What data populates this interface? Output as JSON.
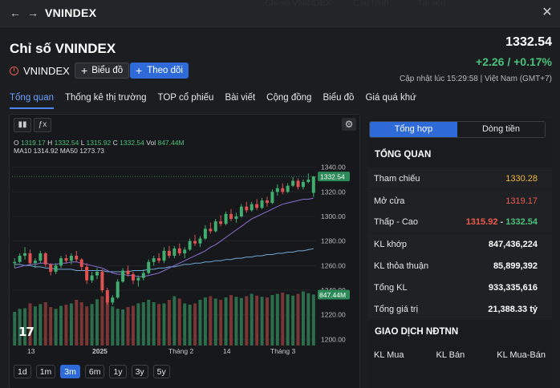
{
  "window": {
    "title": "VNINDEX",
    "ghost_tabs": [
      "Chỉ số VNINDEX",
      "Cấu hình",
      "Tài liệu"
    ]
  },
  "header": {
    "title": "Chỉ số VNINDEX",
    "symbol": "VNINDEX",
    "chart_button": "Biểu đồ",
    "follow_button": "Theo dõi",
    "price": "1332.54",
    "change": "+2.26 / +0.17%",
    "updated": "Cập nhật lúc  15:29:58 | Việt Nam (GMT+7)"
  },
  "tabs": [
    "Tổng quan",
    "Thống kê thị trường",
    "TOP cổ phiếu",
    "Bài viết",
    "Cộng đồng",
    "Biểu đồ",
    "Giá quá khứ"
  ],
  "chart": {
    "ohlc": {
      "o_label": "O",
      "o": "1319.17",
      "h_label": "H",
      "h": "1332.54",
      "l_label": "L",
      "l": "1315.92",
      "c_label": "C",
      "c": "1332.54",
      "vol_label": "Vol",
      "vol": "847.44M"
    },
    "ma": {
      "ma10_label": "MA10",
      "ma10": "1314.92",
      "ma50_label": "MA50",
      "ma50": "1273.73"
    },
    "last_price_tag": "1332.54",
    "volume_tag": "847.44M",
    "ranges": [
      "1d",
      "1m",
      "3m",
      "6m",
      "1y",
      "3y",
      "5y"
    ],
    "active_range": "3m",
    "logo_text": "17"
  },
  "chart_data": {
    "type": "candlestick",
    "y_ticks": [
      "1340.00",
      "1320.00",
      "1300.00",
      "1280.00",
      "1260.00",
      "1240.00",
      "1220.00",
      "1200.00"
    ],
    "ylim": [
      1195,
      1345
    ],
    "x_ticks": [
      "13",
      "2025",
      "Tháng 2",
      "14",
      "Tháng 3"
    ],
    "candles": [
      [
        1262,
        1266,
        1258,
        1263
      ],
      [
        1263,
        1270,
        1262,
        1268
      ],
      [
        1268,
        1275,
        1265,
        1270
      ],
      [
        1270,
        1273,
        1261,
        1262
      ],
      [
        1262,
        1266,
        1258,
        1264
      ],
      [
        1264,
        1272,
        1262,
        1270
      ],
      [
        1270,
        1271,
        1259,
        1261
      ],
      [
        1261,
        1262,
        1252,
        1255
      ],
      [
        1255,
        1262,
        1253,
        1260
      ],
      [
        1260,
        1268,
        1258,
        1266
      ],
      [
        1266,
        1269,
        1262,
        1264
      ],
      [
        1264,
        1270,
        1261,
        1268
      ],
      [
        1268,
        1272,
        1263,
        1265
      ],
      [
        1265,
        1266,
        1256,
        1259
      ],
      [
        1259,
        1262,
        1245,
        1248
      ],
      [
        1248,
        1255,
        1246,
        1252
      ],
      [
        1252,
        1258,
        1249,
        1255
      ],
      [
        1255,
        1257,
        1238,
        1240
      ],
      [
        1240,
        1242,
        1228,
        1230
      ],
      [
        1230,
        1236,
        1228,
        1234
      ],
      [
        1234,
        1249,
        1233,
        1247
      ],
      [
        1247,
        1258,
        1246,
        1256
      ],
      [
        1256,
        1260,
        1251,
        1253
      ],
      [
        1253,
        1255,
        1245,
        1248
      ],
      [
        1248,
        1252,
        1243,
        1250
      ],
      [
        1250,
        1257,
        1248,
        1254
      ],
      [
        1254,
        1265,
        1253,
        1263
      ],
      [
        1263,
        1268,
        1260,
        1266
      ],
      [
        1266,
        1270,
        1262,
        1264
      ],
      [
        1264,
        1275,
        1262,
        1272
      ],
      [
        1272,
        1276,
        1266,
        1268
      ],
      [
        1268,
        1276,
        1266,
        1274
      ],
      [
        1274,
        1278,
        1268,
        1270
      ],
      [
        1270,
        1275,
        1266,
        1273
      ],
      [
        1273,
        1282,
        1272,
        1280
      ],
      [
        1280,
        1285,
        1276,
        1278
      ],
      [
        1278,
        1284,
        1275,
        1282
      ],
      [
        1282,
        1293,
        1281,
        1290
      ],
      [
        1290,
        1295,
        1286,
        1288
      ],
      [
        1288,
        1298,
        1287,
        1296
      ],
      [
        1296,
        1301,
        1292,
        1294
      ],
      [
        1294,
        1304,
        1293,
        1302
      ],
      [
        1302,
        1306,
        1296,
        1298
      ],
      [
        1298,
        1303,
        1295,
        1300
      ],
      [
        1300,
        1310,
        1299,
        1308
      ],
      [
        1308,
        1312,
        1303,
        1305
      ],
      [
        1305,
        1312,
        1304,
        1310
      ],
      [
        1310,
        1314,
        1305,
        1307
      ],
      [
        1307,
        1315,
        1306,
        1313
      ],
      [
        1313,
        1316,
        1308,
        1311
      ],
      [
        1311,
        1322,
        1310,
        1320
      ],
      [
        1320,
        1326,
        1317,
        1323
      ],
      [
        1323,
        1327,
        1318,
        1320
      ],
      [
        1320,
        1327,
        1319,
        1325
      ],
      [
        1325,
        1332,
        1324,
        1329
      ],
      [
        1329,
        1331,
        1322,
        1324
      ],
      [
        1324,
        1330,
        1322,
        1328
      ],
      [
        1328,
        1335,
        1327,
        1330
      ],
      [
        1319.17,
        1332.54,
        1315.92,
        1332.54
      ]
    ],
    "ma10": [
      1258,
      1259,
      1260,
      1261,
      1261,
      1262,
      1262,
      1261,
      1261,
      1262,
      1262,
      1263,
      1263,
      1262,
      1261,
      1260,
      1259,
      1258,
      1256,
      1254,
      1253,
      1253,
      1252,
      1252,
      1251,
      1251,
      1252,
      1253,
      1254,
      1256,
      1258,
      1260,
      1262,
      1264,
      1266,
      1268,
      1270,
      1272,
      1275,
      1277,
      1280,
      1283,
      1286,
      1289,
      1292,
      1295,
      1298,
      1300,
      1302,
      1304,
      1306,
      1308,
      1310,
      1311,
      1312,
      1313,
      1314,
      1314,
      1314.92
    ],
    "ma50": [
      1261,
      1261,
      1260,
      1260,
      1259,
      1259,
      1258,
      1258,
      1257,
      1257,
      1257,
      1257,
      1256,
      1256,
      1256,
      1256,
      1256,
      1256,
      1255,
      1255,
      1255,
      1255,
      1255,
      1256,
      1256,
      1256,
      1257,
      1257,
      1258,
      1258,
      1259,
      1259,
      1260,
      1261,
      1261,
      1262,
      1262,
      1263,
      1263,
      1264,
      1264,
      1265,
      1265,
      1266,
      1266,
      1267,
      1267,
      1268,
      1268,
      1269,
      1269,
      1270,
      1270,
      1271,
      1271,
      1272,
      1272,
      1273,
      1273.73
    ],
    "volumes": [
      560,
      610,
      620,
      700,
      650,
      690,
      720,
      640,
      610,
      660,
      680,
      700,
      760,
      720,
      650,
      690,
      770,
      820,
      740,
      650,
      610,
      600,
      640,
      660,
      700,
      720,
      760,
      720,
      690,
      700,
      760,
      820,
      780,
      700,
      680,
      700,
      760,
      800,
      820,
      780,
      760,
      800,
      840,
      810,
      790,
      820,
      860,
      830,
      810,
      800,
      840,
      860,
      880,
      850,
      830,
      860,
      900,
      870,
      847.44
    ]
  },
  "overview": {
    "seg_tabs": [
      "Tổng hợp",
      "Dòng tiền"
    ],
    "section1": "TỔNG QUAN",
    "rows": [
      {
        "k": "Tham chiếu",
        "v": "1330.28",
        "color": "#f2b73a"
      },
      {
        "k": "Mở cửa",
        "v": "1319.17",
        "color": "#ef5a4c"
      },
      {
        "k": "Thấp - Cao",
        "low": "1315.92",
        "sep": " - ",
        "high": "1332.54"
      },
      {
        "k": "KL khớp",
        "v": "847,436,224",
        "color": "#ffffff"
      },
      {
        "k": "KL thỏa thuận",
        "v": "85,899,392",
        "color": "#ffffff"
      },
      {
        "k": "Tổng KL",
        "v": "933,335,616",
        "color": "#ffffff"
      },
      {
        "k": "Tổng giá trị",
        "v": "21,388.33 tỷ",
        "color": "#ffffff"
      }
    ],
    "section2": "GIAO DỊCH NĐTNN",
    "foreign_cols": [
      "KL Mua",
      "KL Bán",
      "KL Mua-Bán"
    ]
  },
  "colors": {
    "up": "#3fae6e",
    "down": "#e05252",
    "accent": "#2f6bd8"
  }
}
